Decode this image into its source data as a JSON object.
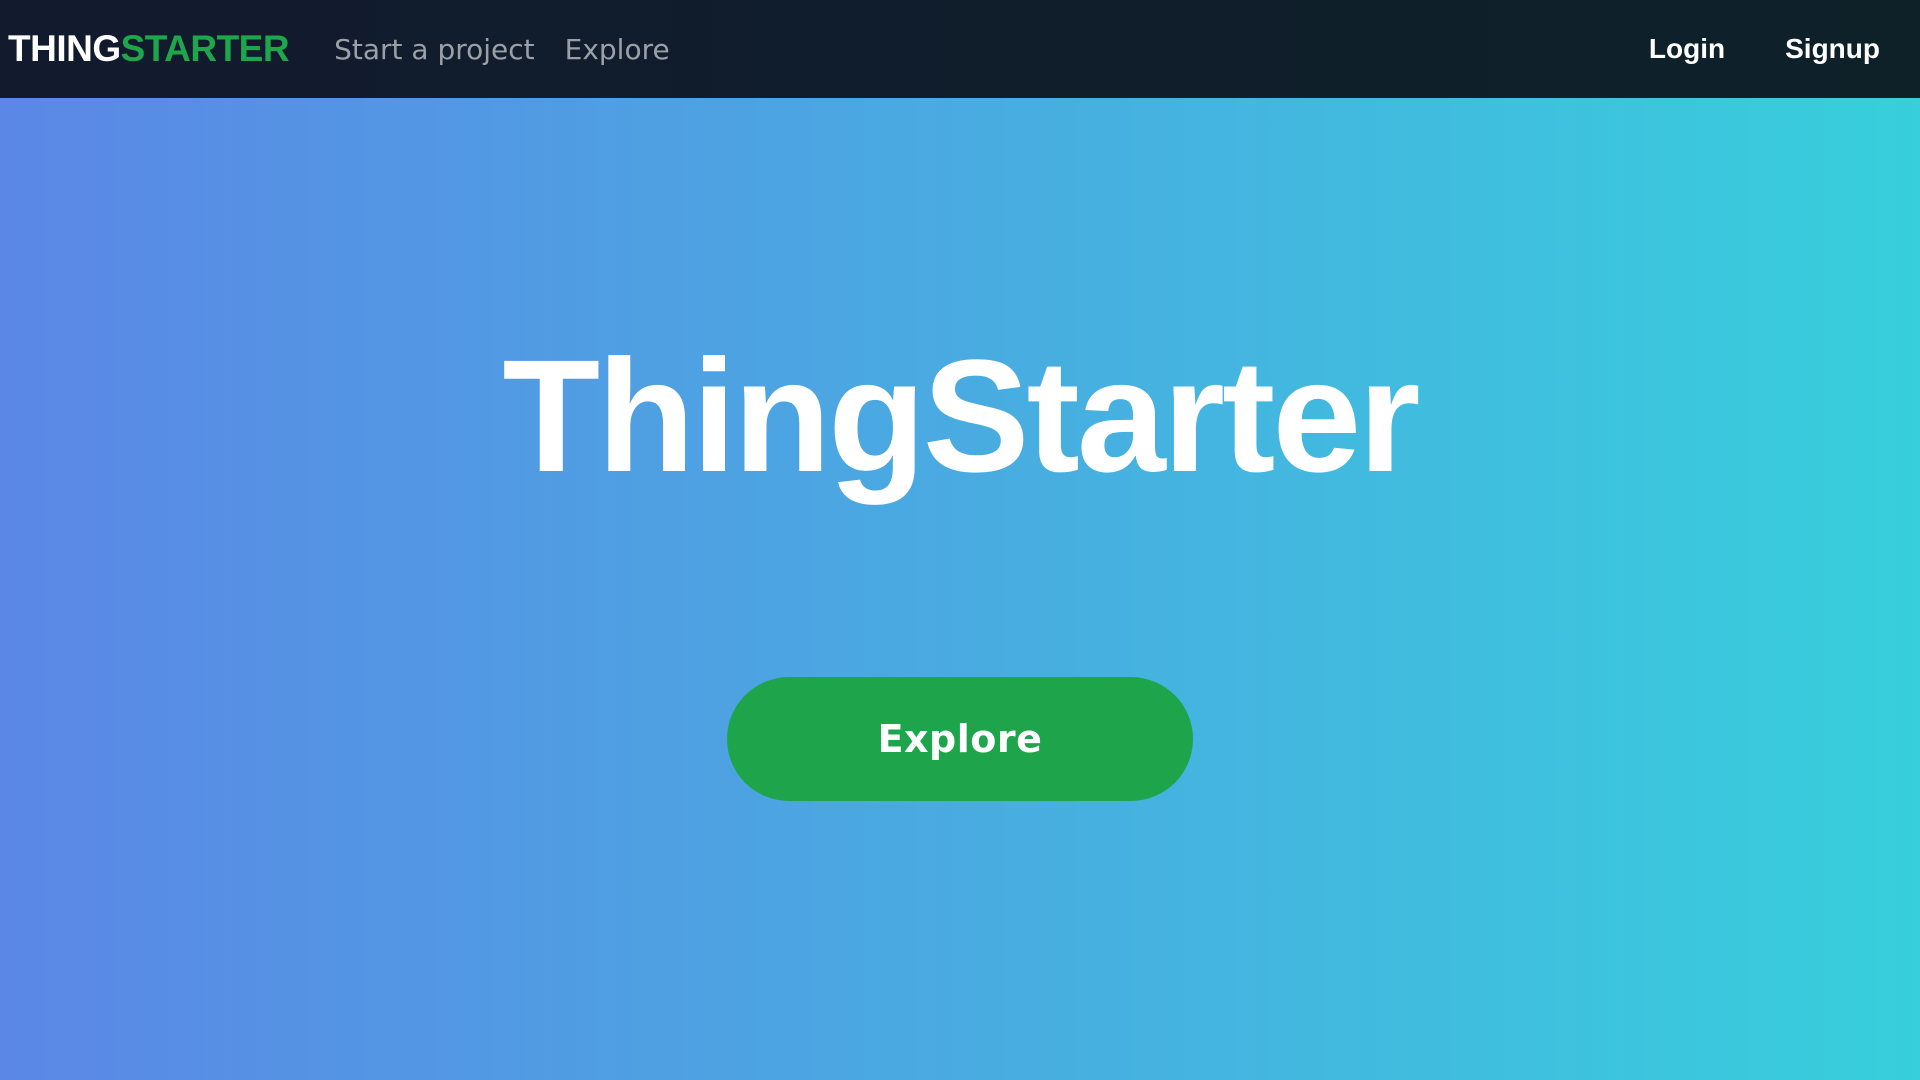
{
  "colors": {
    "navbar_bg_start": "#121a2e",
    "navbar_bg_end": "#0e2129",
    "hero_gradient_start": "#5b87e6",
    "hero_gradient_end": "#37cfdc",
    "brand_accent": "#1fa64a",
    "button_bg": "#1ea54c",
    "nav_link_color": "#9aa0a6",
    "text_white": "#ffffff"
  },
  "navbar": {
    "brand_part_1": "THING",
    "brand_part_2": "STARTER",
    "links": [
      "Start a project",
      "Explore"
    ],
    "login_label": "Login",
    "signup_label": "Signup"
  },
  "hero": {
    "title": "ThingStarter",
    "subtitle": "",
    "cta_label": "Explore"
  }
}
